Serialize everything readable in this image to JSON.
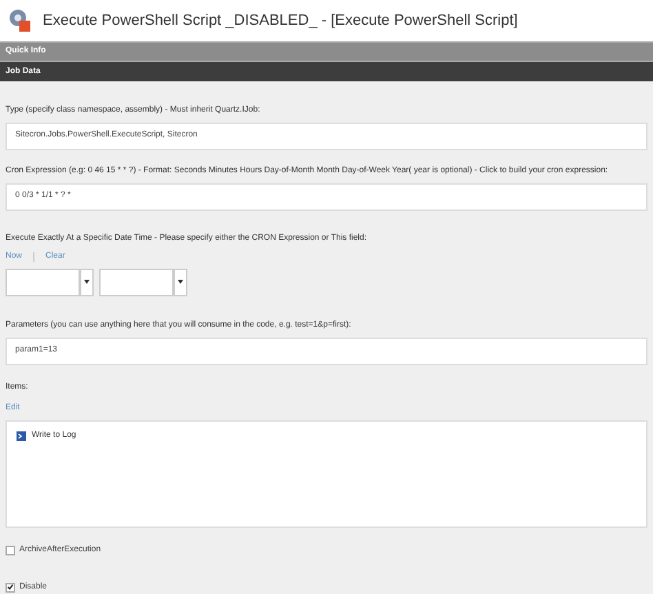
{
  "window": {
    "title": "Execute PowerShell Script _DISABLED_ - [Execute PowerShell Script]"
  },
  "sections": [
    {
      "title": "Quick Info"
    },
    {
      "title": "Job Data"
    }
  ],
  "type_field": {
    "label": "Type (specify class namespace, assembly) - Must inherit Quartz.IJob:",
    "value": "Sitecron.Jobs.PowerShell.ExecuteScript, Sitecron"
  },
  "cron_field": {
    "label": "Cron Expression (e.g: 0 46 15 * * ?) - Format: Seconds Minutes Hours Day-of-Month Month Day-of-Week Year( year is optional) - Click to build your cron expression:",
    "value": "0 0/3 * 1/1 * ? *"
  },
  "execute_at": {
    "label": "Execute Exactly At a Specific Date Time - Please specify either the CRON Expression or This field:",
    "links": [
      "Now",
      "Clear"
    ]
  },
  "parameters_field": {
    "label": "Parameters (you can use anything here that you will consume in the code, e.g. test=1&p=first):",
    "value": "param1=13"
  },
  "items": {
    "label": "Items:",
    "edit_link": "Edit",
    "entries": [
      {
        "name": "Write to Log"
      }
    ]
  },
  "checkboxes": [
    {
      "label": "ArchiveAfterExecution",
      "checked": false
    },
    {
      "label": "Disable",
      "checked": true
    }
  ]
}
